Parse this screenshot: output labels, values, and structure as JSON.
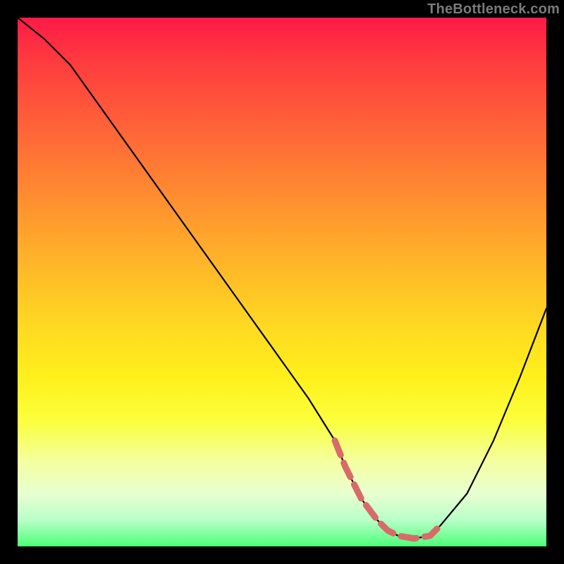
{
  "watermark": "TheBottleneck.com",
  "chart_data": {
    "type": "line",
    "title": "",
    "xlabel": "",
    "ylabel": "",
    "xlim": [
      0,
      100
    ],
    "ylim": [
      0,
      100
    ],
    "grid": false,
    "legend": false,
    "x": [
      0,
      5,
      10,
      15,
      20,
      25,
      30,
      35,
      40,
      45,
      50,
      55,
      60,
      62,
      65,
      68,
      70,
      72,
      75,
      78,
      80,
      85,
      90,
      95,
      100
    ],
    "series": [
      {
        "name": "bottleneck-curve",
        "values": [
          100,
          96,
          91,
          84,
          77,
          70,
          63,
          56,
          49,
          42,
          35,
          28,
          20,
          15,
          9,
          5,
          3,
          2,
          1.5,
          2,
          4,
          10,
          20,
          32,
          45
        ]
      }
    ],
    "highlight_range_x": [
      60,
      80
    ],
    "background_gradient": {
      "top": "#ff1a47",
      "mid": "#ffd822",
      "bottom": "#4dff78"
    },
    "highlight_color": "#d86a6a"
  }
}
